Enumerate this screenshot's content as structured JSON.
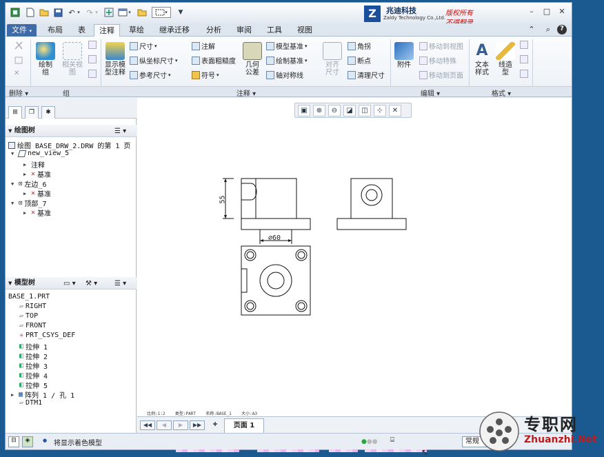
{
  "window_controls": {
    "minimize": "–",
    "restore": "□",
    "close": "✕",
    "help": "?"
  },
  "logo": {
    "mark": "Z",
    "name_cn": "兆迪科技",
    "name_en": "Zaldy Technology Co.,Ltd.",
    "rights_1": "版权所有",
    "rights_2": "不得翻录"
  },
  "tabs": [
    "文件",
    "布局",
    "表",
    "注释",
    "草绘",
    "继承迁移",
    "分析",
    "审阅",
    "工具",
    "视图"
  ],
  "active_tab": "注释",
  "ribbon": {
    "delete_group": "删除",
    "group_group": {
      "label": "组",
      "draw_group": "绘制\n组",
      "related_view": "相关视\n图"
    },
    "annotation_group": {
      "label": "注释",
      "show_model_annotation": "显示模\n型注释",
      "dimension": "尺寸",
      "ordinate_dimension": "纵坐标尺寸",
      "reference_dimension": "参考尺寸",
      "note": "注解",
      "surface_finish": "表面粗糙度",
      "symbol": "符号",
      "geometric_tolerance": "几何\n公差",
      "model_datum": "模型基准",
      "draw_datum": "绘制基准",
      "axis_symmetry": "轴对称线",
      "align_dimension": "对齐\n尺寸",
      "corner": "角拐",
      "break": "断点",
      "cleanup_dimension": "清理尺寸"
    },
    "edit_group": {
      "label": "编辑",
      "attachment": "附件",
      "move_to_view": "移动到视图",
      "move_special": "移动特殊",
      "move_to_page": "移动到页面"
    },
    "format_group": {
      "label": "格式",
      "text_style": "文本\n样式",
      "line_style": "线造\n型"
    }
  },
  "drawing_tree": {
    "header": "绘图树",
    "items": [
      {
        "text": "绘图 BASE_DRW_2.DRW 的第 1 页"
      },
      {
        "text": "new_view_5"
      },
      {
        "text": "注释"
      },
      {
        "text": "基准"
      },
      {
        "text": "左边_6"
      },
      {
        "text": "基准"
      },
      {
        "text": "顶部_7"
      },
      {
        "text": "基准"
      }
    ]
  },
  "model_tree": {
    "header": "模型树",
    "items": [
      "BASE_1.PRT",
      "RIGHT",
      "TOP",
      "FRONT",
      "PRT_CSYS_DEF",
      "拉伸 1",
      "拉伸 2",
      "拉伸 3",
      "拉伸 4",
      "拉伸 5",
      "阵列 1 / 孔 1",
      "DTM1"
    ]
  },
  "drawing": {
    "dim_height": "55",
    "dim_diameter": "∅60",
    "info_bar": {
      "scale": "比例:1:2",
      "type": "类型:PART",
      "name": "名称:BASE_1",
      "size": "大小:A3"
    }
  },
  "pager": {
    "page_label": "页面 1"
  },
  "status": {
    "message": "将显示着色模型",
    "filter": "常规"
  },
  "watermark": {
    "site_cn": "专职网",
    "site_en": "Zhuanzhi.Net"
  }
}
